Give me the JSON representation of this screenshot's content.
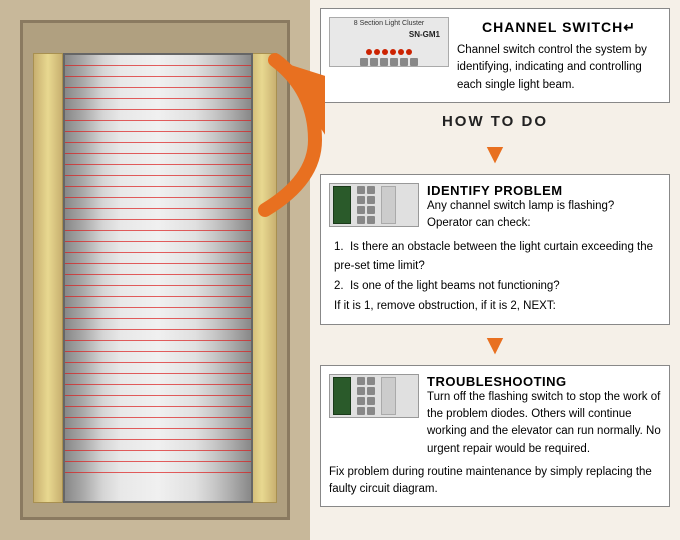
{
  "left": {
    "alt": "Elevator with light curtain beams"
  },
  "right": {
    "channel_switch": {
      "title": "CHANNEL SWITCH↵",
      "description": "Channel switch control the system by identifying, indicating and controlling each single light beam.",
      "device_label": "8 Section Light Cluster",
      "device_model": "SN-GM1"
    },
    "how_to_do": "HOW TO DO",
    "identify": {
      "title": "IDENTIFY PROBLEM",
      "intro": "Any channel switch lamp is flashing? Operator can check:",
      "item1": "Is there an obstacle between the light curtain exceeding the pre-set time limit?",
      "item2": "Is one of the light beams not functioning?",
      "conclusion": "If it is 1, remove obstruction, if it is 2, NEXT:"
    },
    "troubleshoot": {
      "title": "TROUBLESHOOTING",
      "text1": "Turn off the flashing switch to stop the work of the problem diodes.  Others will continue working and the elevator can run normally.  No urgent repair would be required.",
      "text2": "Fix problem during routine maintenance by simply replacing the faulty circuit diagram."
    }
  }
}
